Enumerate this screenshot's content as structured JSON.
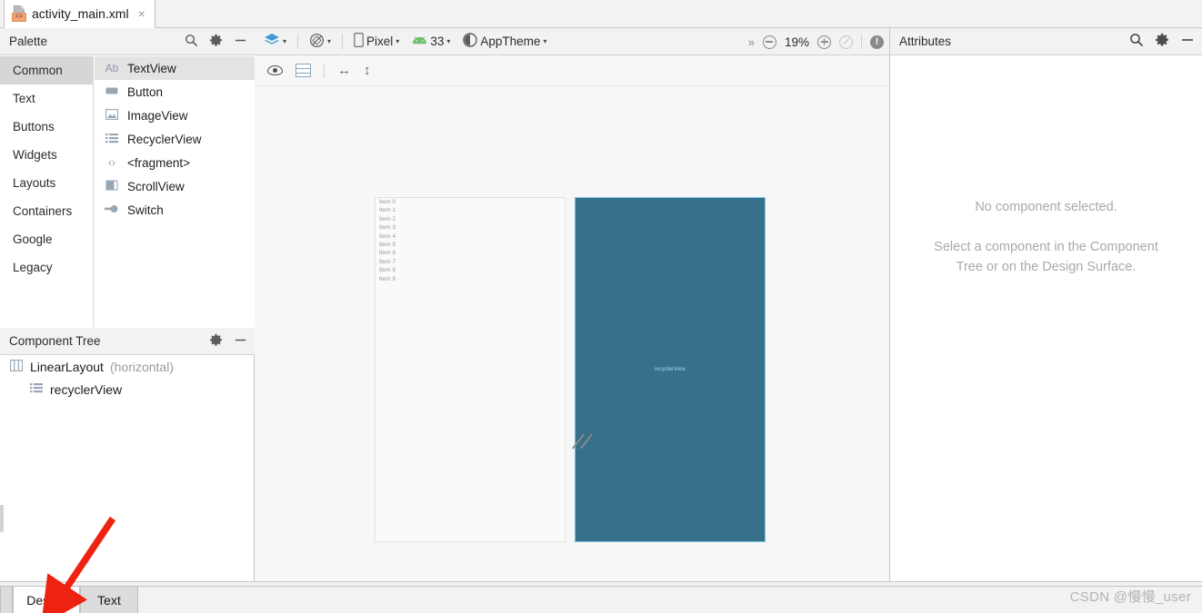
{
  "window": {
    "file_tab": {
      "label": "activity_main.xml",
      "close": "×",
      "icon": "xml-file-icon",
      "badge": "<>"
    }
  },
  "palette": {
    "title": "Palette",
    "search_icon": "search-icon",
    "gear_icon": "gear-icon",
    "minimize_icon": "minimize-icon",
    "categories": [
      {
        "label": "Common",
        "selected": true
      },
      {
        "label": "Text",
        "selected": false
      },
      {
        "label": "Buttons",
        "selected": false
      },
      {
        "label": "Widgets",
        "selected": false
      },
      {
        "label": "Layouts",
        "selected": false
      },
      {
        "label": "Containers",
        "selected": false
      },
      {
        "label": "Google",
        "selected": false
      },
      {
        "label": "Legacy",
        "selected": false
      }
    ],
    "items": [
      {
        "label": "TextView",
        "glyph": "Ab",
        "icon": "textview-icon",
        "selected": true
      },
      {
        "label": "Button",
        "glyph": "▬",
        "icon": "button-icon",
        "selected": false
      },
      {
        "label": "ImageView",
        "glyph": "◢",
        "icon": "imageview-icon",
        "selected": false
      },
      {
        "label": "RecyclerView",
        "glyph": "☰",
        "icon": "recyclerview-icon",
        "selected": false
      },
      {
        "label": "<fragment>",
        "glyph": "‹›",
        "icon": "fragment-icon",
        "selected": false
      },
      {
        "label": "ScrollView",
        "glyph": "▣",
        "icon": "scrollview-icon",
        "selected": false
      },
      {
        "label": "Switch",
        "glyph": "●",
        "icon": "switch-icon",
        "selected": false
      }
    ]
  },
  "component_tree": {
    "title": "Component Tree",
    "gear_icon": "gear-icon",
    "minimize_icon": "minimize-icon",
    "nodes": [
      {
        "label": "LinearLayout",
        "suffix": "(horizontal)",
        "glyph": "⫿n",
        "icon": "linearlayout-icon"
      },
      {
        "label": "recyclerView",
        "suffix": "",
        "glyph": "☰",
        "icon": "recyclerview-icon"
      }
    ]
  },
  "design_toolbar": {
    "layers_label": "",
    "layers_icon": "layers-icon",
    "orientation_icon": "orientation-rotate-icon",
    "device_icon": "phone-icon",
    "device_label": "Pixel",
    "api_icon": "android-icon",
    "api_label": "33",
    "theme_icon": "theme-contrast-icon",
    "theme_label": "AppTheme",
    "overflow": "»",
    "zoom_out_icon": "zoom-out-icon",
    "zoom_level": "19%",
    "zoom_in_icon": "zoom-in-icon",
    "zoom_fit_icon": "zoom-fit-icon",
    "issues_icon": "warning-icon",
    "caret": "▾"
  },
  "design_toolbar2": {
    "eye_icon": "eye-visibility-icon",
    "rows_icon": "blueprint-rows-icon",
    "horizontal_icon": "↔",
    "vertical_icon": "↕"
  },
  "canvas": {
    "device_items": [
      "Item 0",
      "Item 1",
      "Item 2",
      "Item 3",
      "Item 4",
      "Item 5",
      "Item 6",
      "Item 7",
      "Item 8",
      "Item 9"
    ],
    "blueprint_label": "recyclerView",
    "blueprint_color": "#36708a",
    "blueprint_border_color": "#7fc6e8",
    "resize_handle_icon": "resize-handle-icon"
  },
  "attributes": {
    "title": "Attributes",
    "search_icon": "search-icon",
    "gear_icon": "gear-icon",
    "minimize_icon": "minimize-icon",
    "empty_title": "No component selected.",
    "empty_hint": "Select a component in the Component Tree or on the Design Surface."
  },
  "bottom_tabs": {
    "design": "Design",
    "text": "Text"
  },
  "watermark": "CSDN @慢慢_user",
  "annotation": {
    "color": "#ee2211",
    "type": "arrow-pointing-to-design-tab"
  }
}
